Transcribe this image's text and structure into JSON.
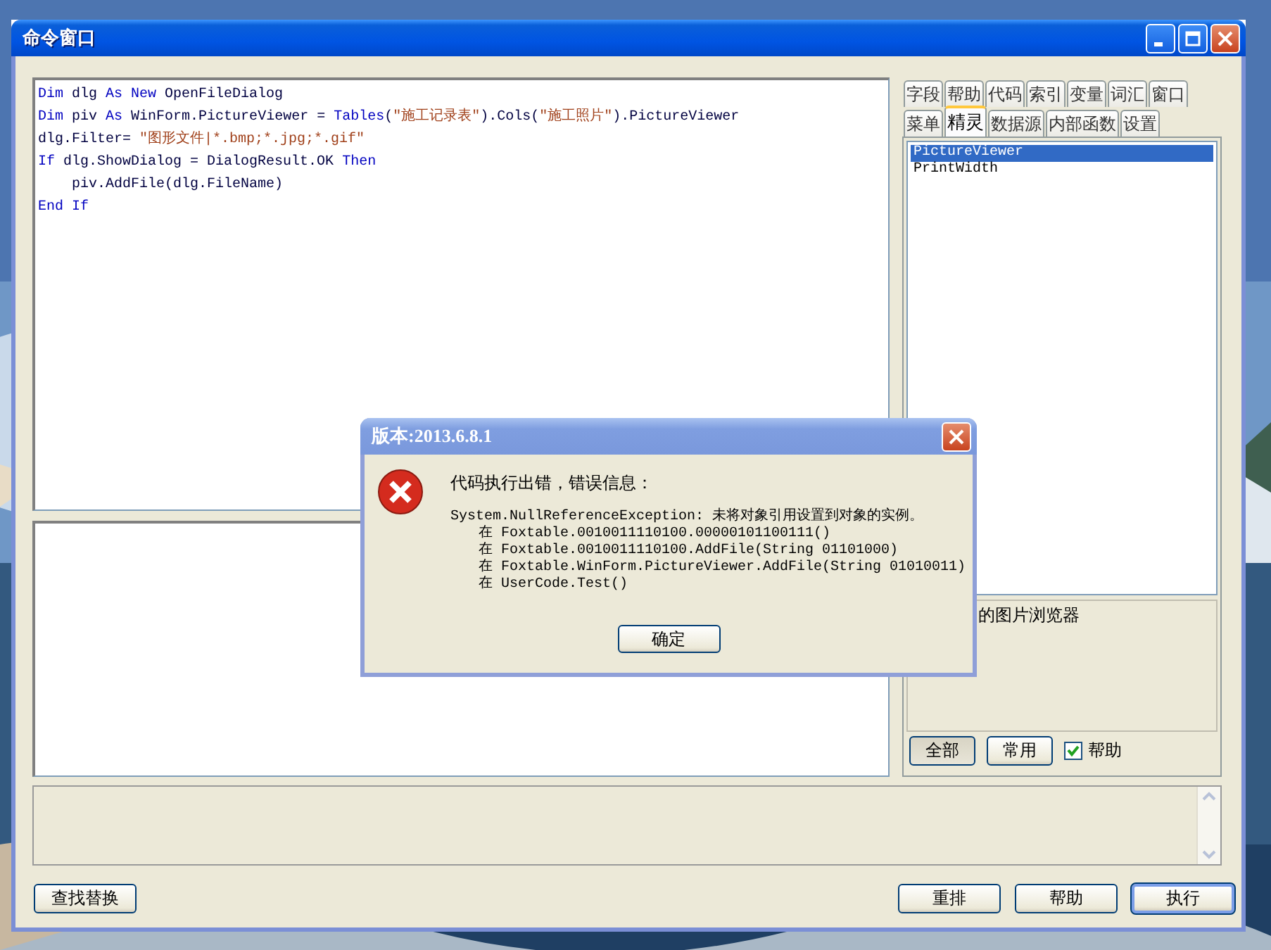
{
  "window": {
    "title": "命令窗口"
  },
  "editor": {
    "lines": [
      [
        {
          "kind": "keyword",
          "text": "Dim"
        },
        {
          "kind": "plain",
          "text": " dlg "
        },
        {
          "kind": "keyword",
          "text": "As New"
        },
        {
          "kind": "plain",
          "text": " OpenFileDialog"
        }
      ],
      [
        {
          "kind": "keyword",
          "text": "Dim"
        },
        {
          "kind": "plain",
          "text": " piv "
        },
        {
          "kind": "keyword",
          "text": "As"
        },
        {
          "kind": "plain",
          "text": " WinForm.PictureViewer = "
        },
        {
          "kind": "keyword",
          "text": "Tables"
        },
        {
          "kind": "plain",
          "text": "("
        },
        {
          "kind": "string",
          "text": "\"施工记录表\""
        },
        {
          "kind": "plain",
          "text": ").Cols("
        },
        {
          "kind": "string",
          "text": "\"施工照片\""
        },
        {
          "kind": "plain",
          "text": ").PictureViewer"
        }
      ],
      [
        {
          "kind": "plain",
          "text": "dlg.Filter= "
        },
        {
          "kind": "string",
          "text": "\"图形文件|*.bmp;*.jpg;*.gif\""
        }
      ],
      [
        {
          "kind": "keyword",
          "text": "If"
        },
        {
          "kind": "plain",
          "text": " dlg.ShowDialog = DialogResult.OK "
        },
        {
          "kind": "keyword",
          "text": "Then"
        }
      ],
      [
        {
          "kind": "plain",
          "text": "    piv.AddFile(dlg.FileName)"
        }
      ],
      [
        {
          "kind": "keyword",
          "text": "End If"
        }
      ]
    ]
  },
  "side_panel": {
    "tab_rows": [
      [
        {
          "label": "字段",
          "selected": false
        },
        {
          "label": "帮助",
          "selected": false
        },
        {
          "label": "代码",
          "selected": false
        },
        {
          "label": "索引",
          "selected": false
        },
        {
          "label": "变量",
          "selected": false
        },
        {
          "label": "词汇",
          "selected": false
        },
        {
          "label": "窗口",
          "selected": false
        }
      ],
      [
        {
          "label": "菜单",
          "selected": false
        },
        {
          "label": "精灵",
          "selected": true
        },
        {
          "label": "数据源",
          "selected": false
        },
        {
          "label": "内部函数",
          "selected": false
        },
        {
          "label": "设置",
          "selected": false
        }
      ]
    ],
    "items": [
      {
        "label": "PictureViewer",
        "selected": true
      },
      {
        "label": "PrintWidth",
        "selected": false
      }
    ],
    "description": "的图片浏览器",
    "filters": [
      {
        "label": "全部",
        "selected": true
      },
      {
        "label": "常用",
        "selected": false
      }
    ],
    "help_checkbox": {
      "label": "帮助",
      "checked": true
    }
  },
  "buttons_left": [
    "查找替换"
  ],
  "buttons_right": [
    "重排",
    "帮助",
    "执行"
  ],
  "dialog": {
    "title": "版本:2013.6.8.1",
    "message": "代码执行出错，错误信息：",
    "exception": "System.NullReferenceException: 未将对象引用设置到对象的实例。",
    "trace": [
      "在 Foxtable.0010011110100.00000101100111()",
      "在 Foxtable.0010011110100.AddFile(String 01101000)",
      "在 Foxtable.WinForm.PictureViewer.AddFile(String 01010011)",
      "在 UserCode.Test()"
    ],
    "ok_button": "确定"
  }
}
